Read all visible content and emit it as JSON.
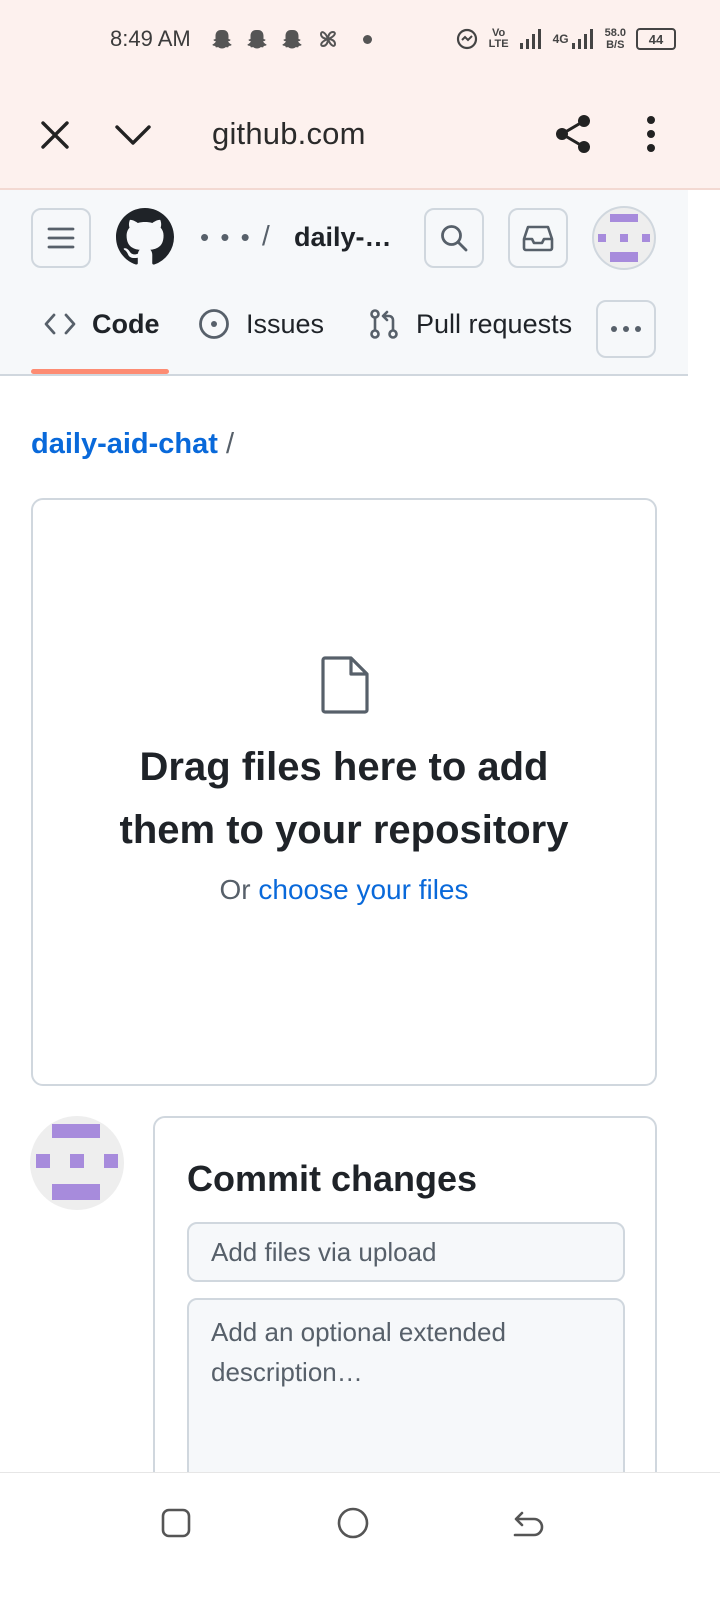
{
  "status_bar": {
    "time": "8:49 AM",
    "volte": "Vo\nLTE",
    "network": "4G",
    "speed_value": "58.0",
    "speed_unit": "B/S",
    "battery": "44"
  },
  "browser": {
    "url": "github.com",
    "icons": [
      "close-icon",
      "chevron-down-icon",
      "share-icon",
      "more-vertical-icon"
    ]
  },
  "github_header": {
    "breadcrumb_ellipsis": "• • •",
    "breadcrumb_separator": "/",
    "repo_short": "daily-…",
    "tabs": [
      {
        "label": "Code",
        "icon": "code-icon",
        "selected": true
      },
      {
        "label": "Issues",
        "icon": "issue-icon",
        "selected": false
      },
      {
        "label": "Pull requests",
        "icon": "pull-request-icon",
        "selected": false
      }
    ],
    "more_label": "• • •"
  },
  "main": {
    "repo_link": "daily-aid-chat",
    "path_separator": "/",
    "dropzone": {
      "title_line1": "Drag files here to add",
      "title_line2": "them to your repository",
      "or_text": "Or",
      "choose_link": "choose your files"
    },
    "commit": {
      "title": "Commit changes",
      "summary_placeholder": "Add files via upload",
      "description_placeholder": "Add an optional extended description…"
    }
  },
  "colors": {
    "accent_link": "#0969da",
    "tab_underline": "#fd8c73",
    "avatar_purple": "#a78bdc",
    "browser_bg": "#fdf1ee"
  }
}
